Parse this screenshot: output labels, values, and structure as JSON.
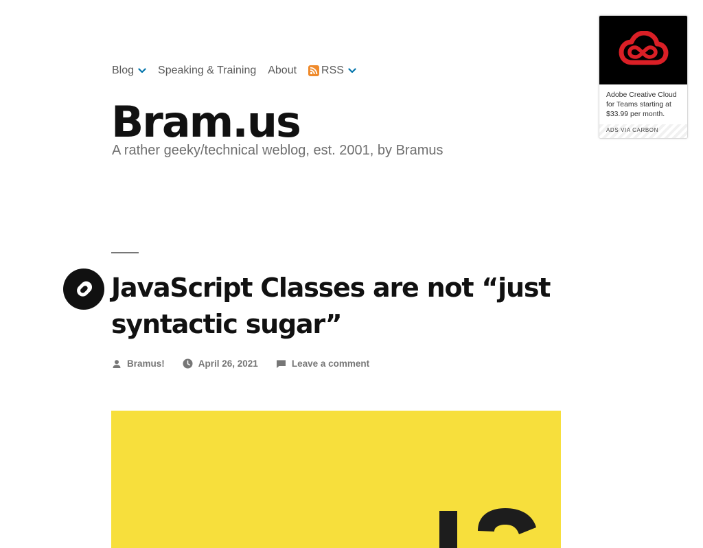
{
  "nav": {
    "items": [
      {
        "label": "Blog",
        "has_dropdown": true
      },
      {
        "label": "Speaking & Training",
        "has_dropdown": false
      },
      {
        "label": "About",
        "has_dropdown": false
      },
      {
        "label": "RSS",
        "has_dropdown": true,
        "icon": "rss-icon"
      }
    ],
    "chevron_color": "#0073aa"
  },
  "site": {
    "title": "Bram.us",
    "description": "A rather geeky/technical weblog, est. 2001, by Bramus"
  },
  "ad": {
    "image_icon": "adobe-creative-cloud-logo",
    "brand_color": "#da1f26",
    "text": "Adobe Creative Cloud for Teams starting at $33.99 per month.",
    "via": "ADS VIA CARBON"
  },
  "post": {
    "format_icon": "link-icon",
    "title": "JavaScript Classes are not “just syntactic sugar”",
    "author": "Bramus!",
    "date": "April 26, 2021",
    "comments": "Leave a comment",
    "hero_color": "#f7df3c"
  }
}
